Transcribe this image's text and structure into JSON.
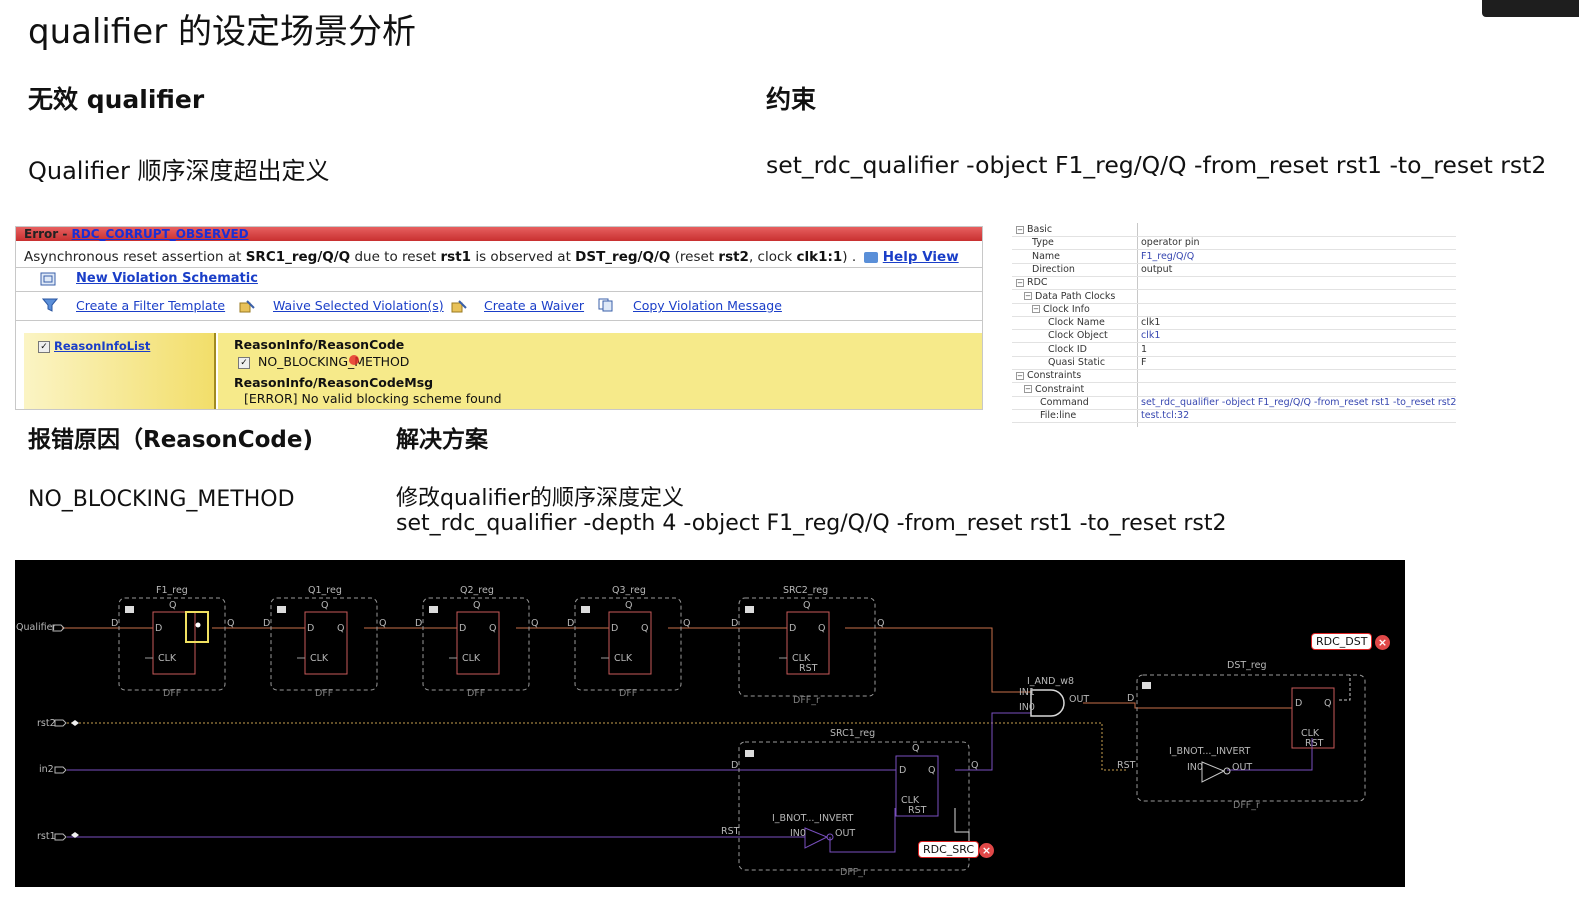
{
  "slide": {
    "title": "qualifier 的设定场景分析",
    "left_heading": "无效 qualifier",
    "right_heading": "约束",
    "left_desc": "Qualifier 顺序深度超出定义",
    "constraint_cmd": "set_rdc_qualifier -object F1_reg/Q/Q -from_reset rst1 -to_reset rst2",
    "reason_heading": "报错原因（ReasonCode)",
    "solution_heading": "解决方案",
    "reason_value": "NO_BLOCKING_METHOD",
    "solution_desc": "修改qualifier的顺序深度定义",
    "solution_cmd": "set_rdc_qualifier  -depth 4 -object F1_reg/Q/Q -from_reset rst1 -to_reset rst2"
  },
  "error_panel": {
    "severity": "Error -",
    "code": "RDC_CORRUPT_OBSERVED",
    "msg_1": "Asynchronous reset assertion at ",
    "src": "SRC1_reg/Q/Q",
    "msg_2": " due to reset ",
    "rst_from": "rst1",
    "msg_3": " is observed at ",
    "dst": "DST_reg/Q/Q",
    "msg_4": " (reset ",
    "rst_to": "rst2",
    "msg_5": ", clock ",
    "clock": "clk1:1",
    "msg_6": ") .",
    "help_link": "Help View",
    "new_schematic": "New Violation Schematic",
    "actions": {
      "filter": "Create a Filter Template",
      "waive": "Waive Selected Violation(s)",
      "waiver": "Create a Waiver",
      "copy": "Copy Violation Message"
    },
    "reason_list": "ReasonInfoList",
    "reason_code_label": "ReasonInfo/ReasonCode",
    "reason_code_value": "NO_BLOCKING_METHOD",
    "reason_msg_label": "ReasonInfo/ReasonCodeMsg",
    "reason_msg_value": "[ERROR] No valid blocking scheme found"
  },
  "properties": {
    "rows": [
      {
        "key": "Basic",
        "value": "",
        "level": 0,
        "exp": true
      },
      {
        "key": "Type",
        "value": "operator pin",
        "level": 2,
        "exp": false,
        "plain": true
      },
      {
        "key": "Name",
        "value": "F1_reg/Q/Q",
        "level": 2,
        "exp": false
      },
      {
        "key": "Direction",
        "value": "output",
        "level": 2,
        "exp": false,
        "plain": true
      },
      {
        "key": "RDC",
        "value": "",
        "level": 0,
        "exp": true
      },
      {
        "key": "Data Path Clocks",
        "value": "",
        "level": 1,
        "exp": true
      },
      {
        "key": "Clock Info",
        "value": "",
        "level": 2,
        "exp": true
      },
      {
        "key": "Clock Name",
        "value": "clk1",
        "level": 4,
        "exp": false,
        "plain": true
      },
      {
        "key": "Clock Object",
        "value": "clk1",
        "level": 4,
        "exp": false
      },
      {
        "key": "Clock ID",
        "value": "1",
        "level": 4,
        "exp": false,
        "plain": true
      },
      {
        "key": "Quasi Static",
        "value": "F",
        "level": 4,
        "exp": false,
        "plain": true
      },
      {
        "key": "Constraints",
        "value": "",
        "level": 0,
        "exp": true
      },
      {
        "key": "Constraint",
        "value": "",
        "level": 1,
        "exp": true
      },
      {
        "key": "Command",
        "value": "set_rdc_qualifier -object F1_reg/Q/Q -from_reset rst1 -to_reset rst2",
        "level": 3,
        "exp": false
      },
      {
        "key": "File:line",
        "value": "test.tcl:32",
        "level": 3,
        "exp": false
      }
    ]
  },
  "schematic": {
    "ports": {
      "qualifier": "Qualifier",
      "rst2": "rst2",
      "in2": "in2",
      "rst1": "rst1"
    },
    "chain_regs": [
      {
        "name": "F1_reg",
        "type": "DFF"
      },
      {
        "name": "Q1_reg",
        "type": "DFF"
      },
      {
        "name": "Q2_reg",
        "type": "DFF"
      },
      {
        "name": "Q3_reg",
        "type": "DFF"
      }
    ],
    "src2": {
      "name": "SRC2_reg",
      "type": "DFF_r"
    },
    "src1": {
      "name": "SRC1_reg",
      "type": "DFF_r",
      "inv": "I_BNOT..._INVERT"
    },
    "dst": {
      "name": "DST_reg",
      "type": "DFF_r",
      "inv": "I_BNOT..._INVERT"
    },
    "and_gate": {
      "name": "I_AND_w8",
      "in1": "IN1",
      "in0": "IN0",
      "out": "OUT"
    },
    "pins": {
      "d": "D",
      "q": "Q",
      "clk": "CLK",
      "rst": "RST",
      "in0": "IN0",
      "out": "OUT"
    },
    "badge_dst": "RDC_DST",
    "badge_src": "RDC_SRC",
    "badge_close": "×"
  }
}
